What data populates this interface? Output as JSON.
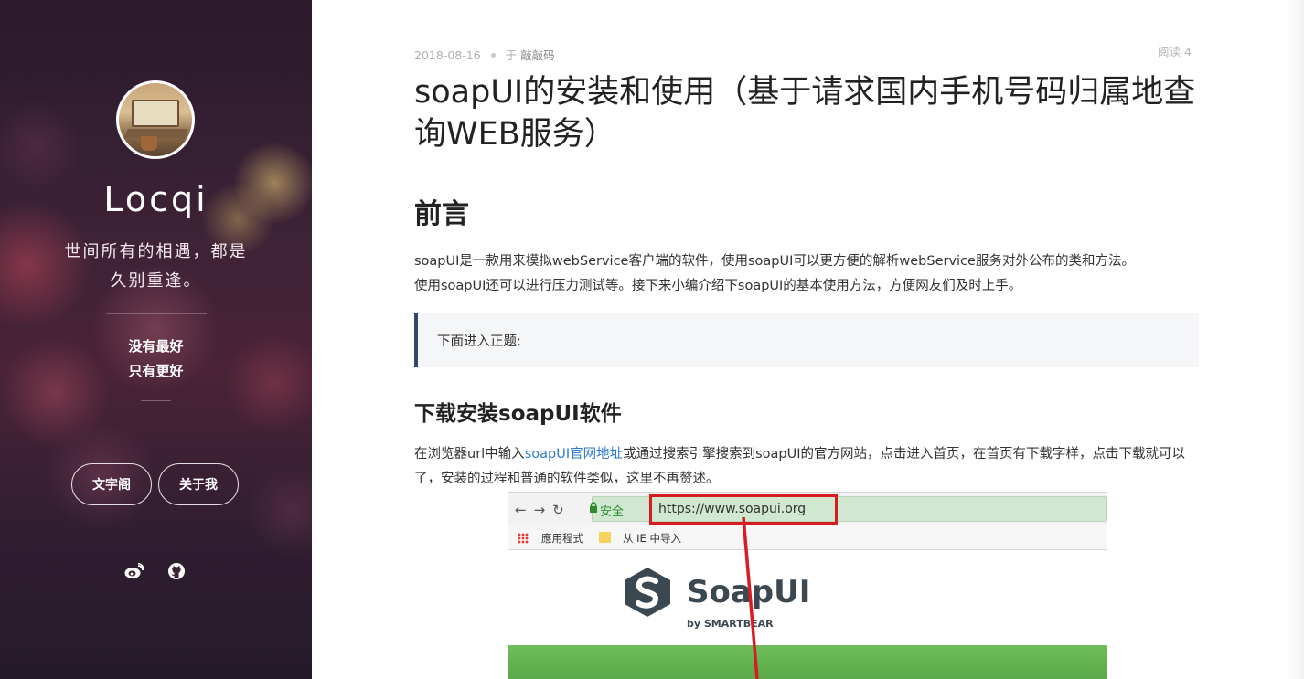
{
  "sidebar": {
    "site_name": "Locqi",
    "motto_line1": "世间所有的相遇，都是",
    "motto_line2": "久别重逢。",
    "slogan_line1": "没有最好",
    "slogan_line2": "只有更好",
    "nav": [
      {
        "label": "文字阁"
      },
      {
        "label": "关于我"
      }
    ],
    "social": [
      {
        "icon": "weibo-icon"
      },
      {
        "icon": "github-icon"
      }
    ]
  },
  "post": {
    "date": "2018-08-16",
    "category_prefix": "于",
    "category": "敲敲码",
    "reads": "阅读 4",
    "title": "soapUI的安装和使用（基于请求国内手机号码归属地查询WEB服务）",
    "section1_heading": "前言",
    "intro_line1": "soapUI是一款用来模拟webService客户端的软件，使用soapUI可以更方便的解析webService服务对外公布的类和方法。",
    "intro_line2": "使用soapUI还可以进行压力测试等。接下来小编介绍下soapUI的基本使用方法，方便网友们及时上手。",
    "quote": "下面进入正题:",
    "section2_heading": "下载安装soapUI软件",
    "para2_before": "在浏览器url中输入",
    "para2_link": "soapUI官网地址",
    "para2_after": "或通过搜索引擎搜索到soapUI的官方网站，点击进入首页，在首页有下载字样，点击下载就可以了，安装的过程和普通的软件类似，这里不再赘述。"
  },
  "screenshot": {
    "secure_label": "安全",
    "url": "https://www.soapui.org",
    "bookmark1": "應用程式",
    "bookmark2": "从 IE 中导入",
    "logo_text": "SoapUI",
    "logo_sub": "by SMARTBEAR",
    "highlight_color": "#d81c24"
  },
  "colors": {
    "link": "#2e7bcf",
    "quote_border": "#2d4a6b"
  }
}
